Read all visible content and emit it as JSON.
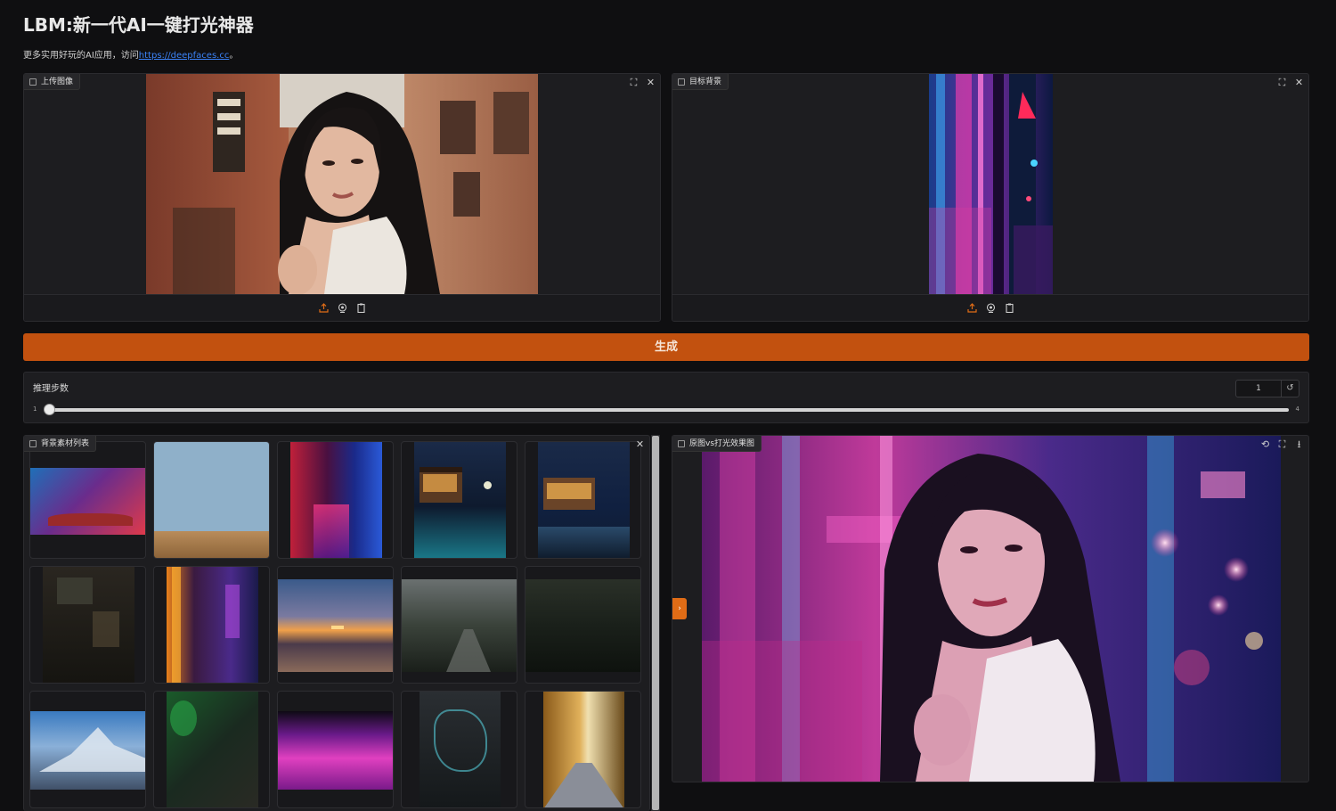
{
  "header": {
    "title": "LBM:新一代AI一键打光神器",
    "subtitle_prefix": "更多实用好玩的AI应用，访问",
    "link_text": "https://deepfaces.cc",
    "subtitle_suffix": "。"
  },
  "upload_panel": {
    "label": "上传图像"
  },
  "target_panel": {
    "label": "目标背景"
  },
  "generate": {
    "label": "生成"
  },
  "slider": {
    "label": "推理步数",
    "value": "1",
    "min": "1",
    "max": "4",
    "fraction": 0
  },
  "gallery": {
    "label": "背景素材列表",
    "item_count": 15
  },
  "result": {
    "label": "原图vs打光效果图"
  },
  "icons": {
    "upload": "upload-icon",
    "webcam": "webcam-icon",
    "clipboard": "clipboard-icon",
    "fullscreen": "fullscreen-icon",
    "close": "close-icon",
    "reset": "reset-icon",
    "undo": "undo-icon",
    "download": "download-icon"
  },
  "colors": {
    "accent": "#c2510f",
    "handle": "#e06c16",
    "link": "#3b82f6",
    "background": "#0f0f11"
  }
}
